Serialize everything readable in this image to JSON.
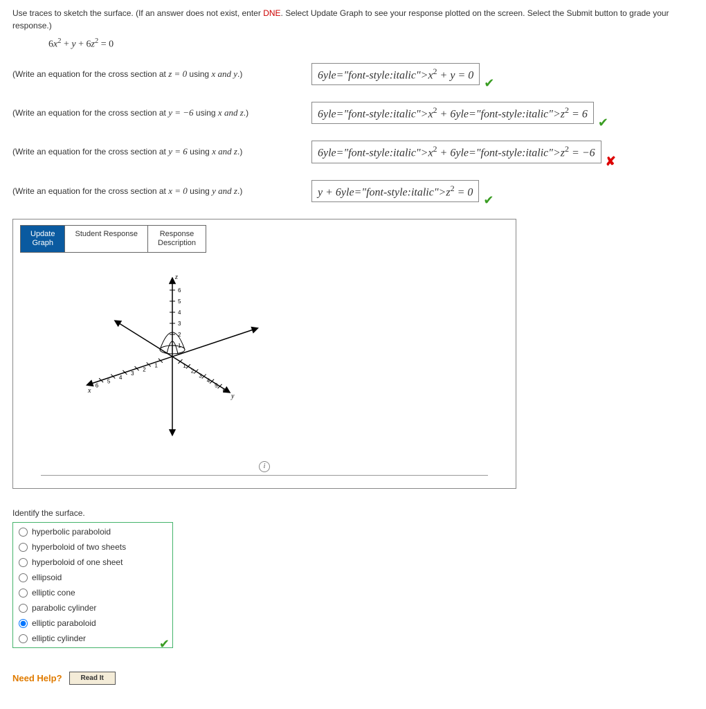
{
  "instruction_pre": "Use traces to sketch the surface. (If an answer does not exist, enter ",
  "instruction_dne": "DNE",
  "instruction_post": ". Select Update Graph to see your response plotted on the screen. Select the Submit button to grade your response.)",
  "main_equation_html": "6x² + y + 6z² = 0",
  "rows": [
    {
      "prompt_pre": "(Write an equation for the cross section at ",
      "cond": "z = 0",
      "prompt_mid": " using ",
      "vars": "x and y",
      "prompt_post": ".)",
      "answer": "6x² + y = 0",
      "correct": true
    },
    {
      "prompt_pre": "(Write an equation for the cross section at ",
      "cond": "y = −6",
      "prompt_mid": " using ",
      "vars": "x and z",
      "prompt_post": ".)",
      "answer": "6x² + 6z² = 6",
      "correct": true
    },
    {
      "prompt_pre": "(Write an equation for the cross section at ",
      "cond": "y = 6",
      "prompt_mid": " using ",
      "vars": "x and z",
      "prompt_post": ".)",
      "answer": "6x² + 6z² = −6",
      "correct": false
    },
    {
      "prompt_pre": "(Write an equation for the cross section at ",
      "cond": "x = 0",
      "prompt_mid": " using ",
      "vars": "y and z",
      "prompt_post": ".)",
      "answer": "y + 6z² = 0",
      "correct": true
    }
  ],
  "tabs": {
    "update": "Update\nGraph",
    "student": "Student Response",
    "desc": "Response\nDescription"
  },
  "axes": {
    "x": "x",
    "y": "y",
    "z": "z",
    "ticks": [
      1,
      2,
      3,
      4,
      5,
      6
    ]
  },
  "identify_label": "Identify the surface.",
  "choices": [
    {
      "label": "hyperbolic paraboloid",
      "selected": false
    },
    {
      "label": "hyperboloid of two sheets",
      "selected": false
    },
    {
      "label": "hyperboloid of one sheet",
      "selected": false
    },
    {
      "label": "ellipsoid",
      "selected": false
    },
    {
      "label": "elliptic cone",
      "selected": false
    },
    {
      "label": "parabolic cylinder",
      "selected": false
    },
    {
      "label": "elliptic paraboloid",
      "selected": true
    },
    {
      "label": "elliptic cylinder",
      "selected": false
    }
  ],
  "choices_correct": true,
  "need_help": "Need Help?",
  "read_it": "Read It"
}
